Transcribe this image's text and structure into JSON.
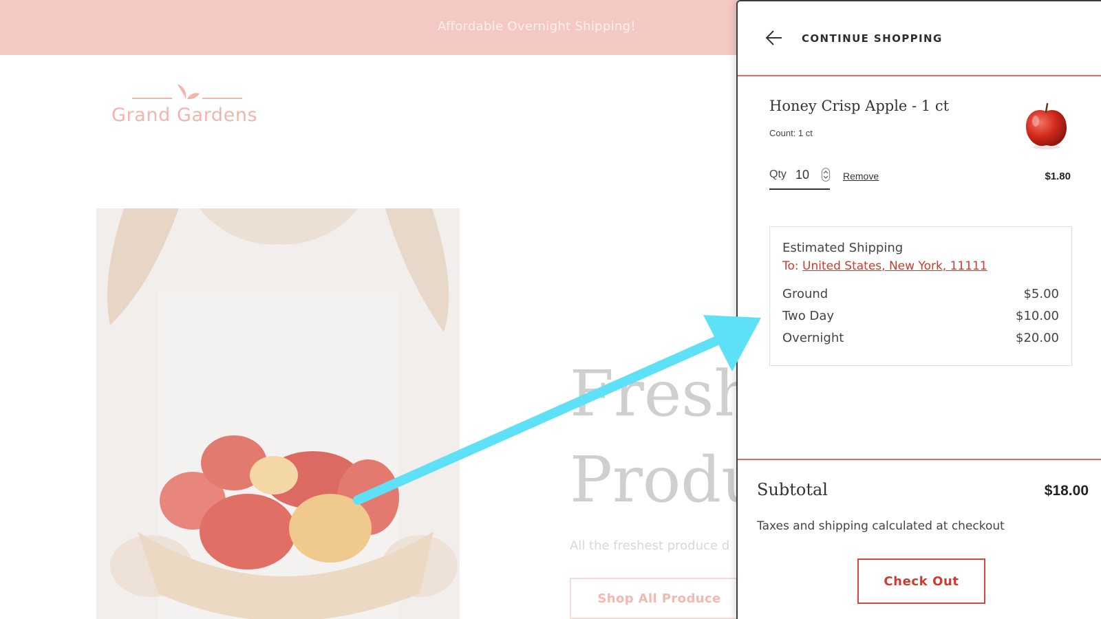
{
  "store": {
    "announcement": "Affordable Overnight Shipping!",
    "logo_text": "Grand Gardens",
    "hero_title_line1": "Fresh",
    "hero_title_line2": "Produ",
    "hero_subtitle": "All the freshest produce d",
    "shop_button": "Shop All Produce"
  },
  "cart": {
    "continue_label": "CONTINUE SHOPPING",
    "item": {
      "title": "Honey Crisp Apple - 1 ct",
      "variant": "Count: 1 ct",
      "qty_label": "Qty",
      "qty_value": "10",
      "remove_label": "Remove",
      "price": "$1.80",
      "thumb_icon": "apple-icon"
    },
    "shipping": {
      "title": "Estimated Shipping",
      "to_prefix": "To: ",
      "destination": "United States, New York, 11111",
      "options": [
        {
          "name": "Ground",
          "price": "$5.00"
        },
        {
          "name": "Two Day",
          "price": "$10.00"
        },
        {
          "name": "Overnight",
          "price": "$20.00"
        }
      ]
    },
    "subtotal_label": "Subtotal",
    "subtotal_value": "$18.00",
    "tax_note": "Taxes and shipping calculated at checkout",
    "checkout_label": "Check Out"
  },
  "colors": {
    "accent": "#cc3b2d",
    "divider": "#e8685c",
    "announcement_bg": "#f5c9c3",
    "annotation_arrow": "#5ee1f7"
  }
}
